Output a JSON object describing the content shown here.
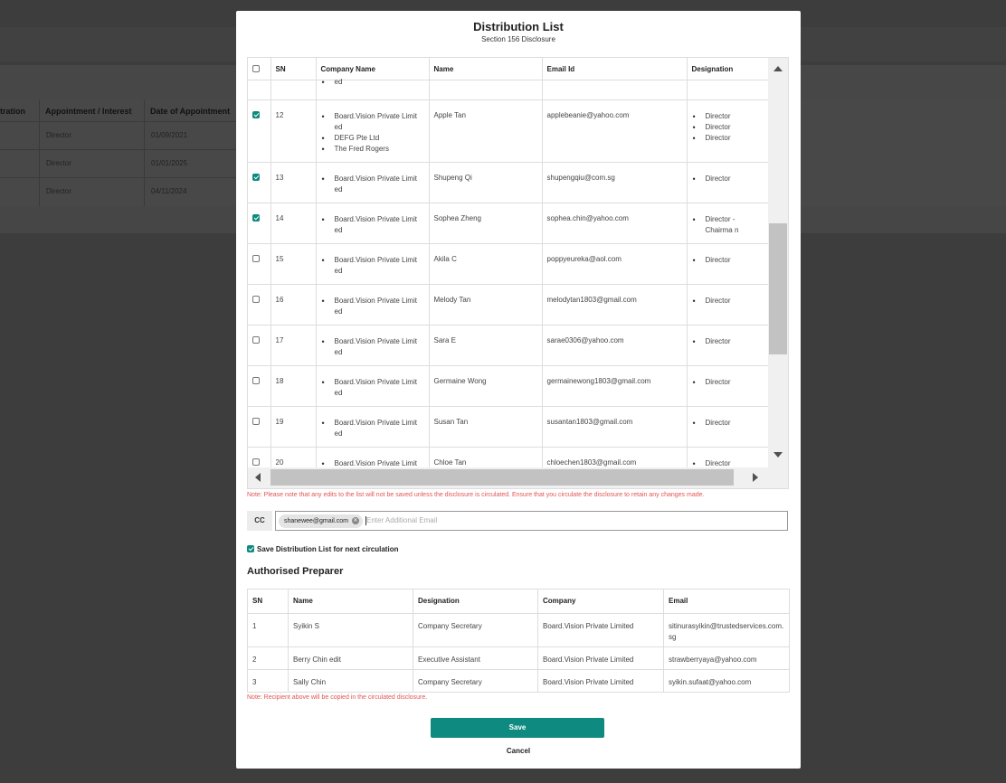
{
  "background": {
    "columns": [
      "tration",
      "Appointment / Interest",
      "Date of Appointment"
    ],
    "rows": [
      {
        "role": "Director",
        "date": "01/09/2021"
      },
      {
        "role": "Director",
        "date": "01/01/2025"
      },
      {
        "role": "Director",
        "date": "04/11/2024"
      }
    ]
  },
  "modal": {
    "title": "Distribution List",
    "subtitle": "Section 156 Disclosure"
  },
  "grid": {
    "headers": {
      "sn": "SN",
      "company": "Company Name",
      "name": "Name",
      "email": "Email Id",
      "designation": "Designation"
    },
    "partial_top_company": "ed",
    "rows": [
      {
        "checked": true,
        "sn": "12",
        "companies": [
          "Board.Vision Private Limit ed",
          "DEFG Pte Ltd",
          "The Fred Rogers"
        ],
        "name": "Apple Tan",
        "email": "applebeanie@yahoo.com",
        "designations": [
          "Director",
          "Director",
          "Director"
        ]
      },
      {
        "checked": true,
        "sn": "13",
        "companies": [
          "Board.Vision Private Limit ed"
        ],
        "name": "Shupeng Qi",
        "email": "shupengqiu@com.sg",
        "designations": [
          "Director"
        ]
      },
      {
        "checked": true,
        "sn": "14",
        "companies": [
          "Board.Vision Private Limit ed"
        ],
        "name": "Sophea Zheng",
        "email": "sophea.chin@yahoo.com",
        "designations": [
          "Director - Chairma n"
        ]
      },
      {
        "checked": false,
        "sn": "15",
        "companies": [
          "Board.Vision Private Limit ed"
        ],
        "name": "Akila C",
        "email": "poppyeureka@aol.com",
        "designations": [
          "Director"
        ]
      },
      {
        "checked": false,
        "sn": "16",
        "companies": [
          "Board.Vision Private Limit ed"
        ],
        "name": "Melody Tan",
        "email": "melodytan1803@gmail.com",
        "designations": [
          "Director"
        ]
      },
      {
        "checked": false,
        "sn": "17",
        "companies": [
          "Board.Vision Private Limit ed"
        ],
        "name": "Sara E",
        "email": "sarae0306@yahoo.com",
        "designations": [
          "Director"
        ]
      },
      {
        "checked": false,
        "sn": "18",
        "companies": [
          "Board.Vision Private Limit ed"
        ],
        "name": "Germaine Wong",
        "email": "germainewong1803@gmail.com",
        "designations": [
          "Director"
        ]
      },
      {
        "checked": false,
        "sn": "19",
        "companies": [
          "Board.Vision Private Limit ed"
        ],
        "name": "Susan Tan",
        "email": "susantan1803@gmail.com",
        "designations": [
          "Director"
        ]
      },
      {
        "checked": false,
        "sn": "20",
        "companies": [
          "Board.Vision Private Limit"
        ],
        "name": "Chloe Tan",
        "email": "chloechen1803@gmail.com",
        "designations": [
          "Director"
        ]
      }
    ]
  },
  "note_edits": "Note: Please note that any edits to the list will not be saved unless the disclosure is circulated. Ensure that you circulate the disclosure to retain any changes made.",
  "cc": {
    "label": "CC",
    "chip": "shanewee@gmail.com",
    "placeholder": "Enter Additional Email"
  },
  "save_list_label": "Save Distribution List for next circulation",
  "preparer": {
    "title": "Authorised Preparer",
    "headers": {
      "sn": "SN",
      "name": "Name",
      "designation": "Designation",
      "company": "Company",
      "email": "Email"
    },
    "rows": [
      {
        "sn": "1",
        "name": "Syikin S",
        "designation": "Company Secretary",
        "company": "Board.Vision Private Limited",
        "email": "sitinurasyikin@trustedservices.com.sg"
      },
      {
        "sn": "2",
        "name": "Berry Chin edit",
        "designation": "Executive Assistant",
        "company": "Board.Vision Private Limited",
        "email": "strawberryaya@yahoo.com"
      },
      {
        "sn": "3",
        "name": "Sally Chin",
        "designation": "Company Secretary",
        "company": "Board.Vision Private Limited",
        "email": "syikin.sufaat@yahoo.com"
      }
    ],
    "note": "Note: Recipient above will be copied in the circulated disclosure."
  },
  "buttons": {
    "save": "Save",
    "cancel": "Cancel"
  },
  "colors": {
    "accent": "#0f8a80",
    "note": "#e25454",
    "overlay": "#3d3d3d"
  }
}
